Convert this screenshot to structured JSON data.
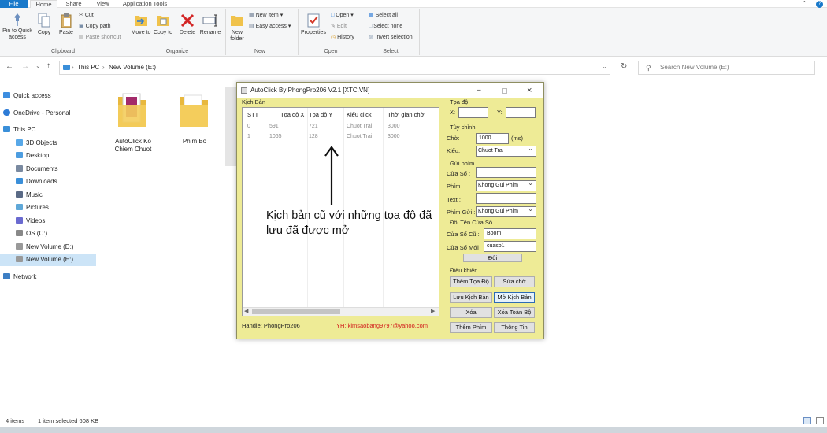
{
  "ribbon_tabs": [
    "File",
    "Home",
    "Share",
    "View",
    "Application Tools"
  ],
  "ribbon": {
    "pin": "Pin to Quick access",
    "copy": "Copy",
    "paste": "Paste",
    "cut": "Cut",
    "copy_path": "Copy path",
    "paste_shortcut": "Paste shortcut",
    "move_to": "Move to",
    "copy_to": "Copy to",
    "delete": "Delete",
    "rename": "Rename",
    "new_folder": "New folder",
    "new_item": "New item",
    "easy_access": "Easy access",
    "properties": "Properties",
    "open": "Open",
    "edit": "Edit",
    "history": "History",
    "select_all": "Select all",
    "select_none": "Select none",
    "invert_selection": "Invert selection",
    "groups": [
      "Clipboard",
      "Organize",
      "New",
      "Open",
      "Select"
    ]
  },
  "address": {
    "crumbs": [
      "This PC",
      "New Volume (E:)"
    ],
    "search_placeholder": "Search New Volume (E:)"
  },
  "nav": [
    {
      "label": "Quick access",
      "color": "#3d8ee0"
    },
    {
      "label": "OneDrive - Personal",
      "color": "#2d7bd6"
    },
    {
      "label": "This PC",
      "color": "#3a8fd9"
    },
    {
      "label": "3D Objects",
      "color": "#58a8e8"
    },
    {
      "label": "Desktop",
      "color": "#4d9de0"
    },
    {
      "label": "Documents",
      "color": "#7a8aa0"
    },
    {
      "label": "Downloads",
      "color": "#3a8fd9"
    },
    {
      "label": "Music",
      "color": "#5a6a86"
    },
    {
      "label": "Pictures",
      "color": "#5fa8d8"
    },
    {
      "label": "Videos",
      "color": "#6a6ad0"
    },
    {
      "label": "OS (C:)",
      "color": "#888"
    },
    {
      "label": "New Volume (D:)",
      "color": "#999"
    },
    {
      "label": "New Volume (E:)",
      "color": "#999"
    },
    {
      "label": "Network",
      "color": "#3d7fc4"
    }
  ],
  "files": [
    {
      "name": "AutoClick Ko Chiem Chuot"
    },
    {
      "name": "Phim Bo"
    }
  ],
  "status": {
    "items": "4 items",
    "selected": "1 item selected  608 KB"
  },
  "app": {
    "title": "AutoClick By PhongPro206 V2.1 [XTC.VN]",
    "script_group": "Kịch Bản",
    "columns": [
      "STT",
      "Tọa độ X",
      "Tọa độ Y",
      "Kiểu click",
      "Thời gian chờ"
    ],
    "rows": [
      [
        "0",
        "591",
        "721",
        "Chuot Trai",
        "3000"
      ],
      [
        "1",
        "1065",
        "128",
        "Chuot Trai",
        "3000"
      ]
    ],
    "annotation": "Kịch bản cũ với những tọa độ đã lưu đã được mở",
    "handle": "Handle: PhongPro206",
    "yh": "YH: kimsaobang9797@yahoo.com",
    "coord_group": "Tọa độ",
    "x_label": "X:",
    "y_label": "Y:",
    "custom_group": "Tùy chỉnh",
    "wait_label": "Chờ:",
    "wait_value": "1000",
    "ms": "(ms)",
    "type_label": "Kiểu:",
    "type_value": "Chuot Trai",
    "sendkey_group": "Gửi phím",
    "window_label": "Cửa Sổ :",
    "key_label": "Phím",
    "key_value": "Khong Gui Phim",
    "text_label": "Text :",
    "sendkey_label": "Phím Gửi :",
    "sendkey_value": "Khong Gui Phim",
    "rename_group": "Đổi Tên Cửa Sổ",
    "old_window_label": "Cửa Sổ Cũ :",
    "old_window_value": "Boom",
    "new_window_label": "Cửa Sổ Mới",
    "new_window_value": "cuaso1",
    "rename_btn": "Đổi",
    "control_group": "Điều khiển",
    "buttons": [
      "Thêm Tọa Độ",
      "Sửa chờ",
      "Lưu Kịch Bản",
      "Mở Kịch Bản",
      "Xóa",
      "Xóa Toàn Bộ",
      "Thêm Phím",
      "Thông Tin"
    ]
  }
}
